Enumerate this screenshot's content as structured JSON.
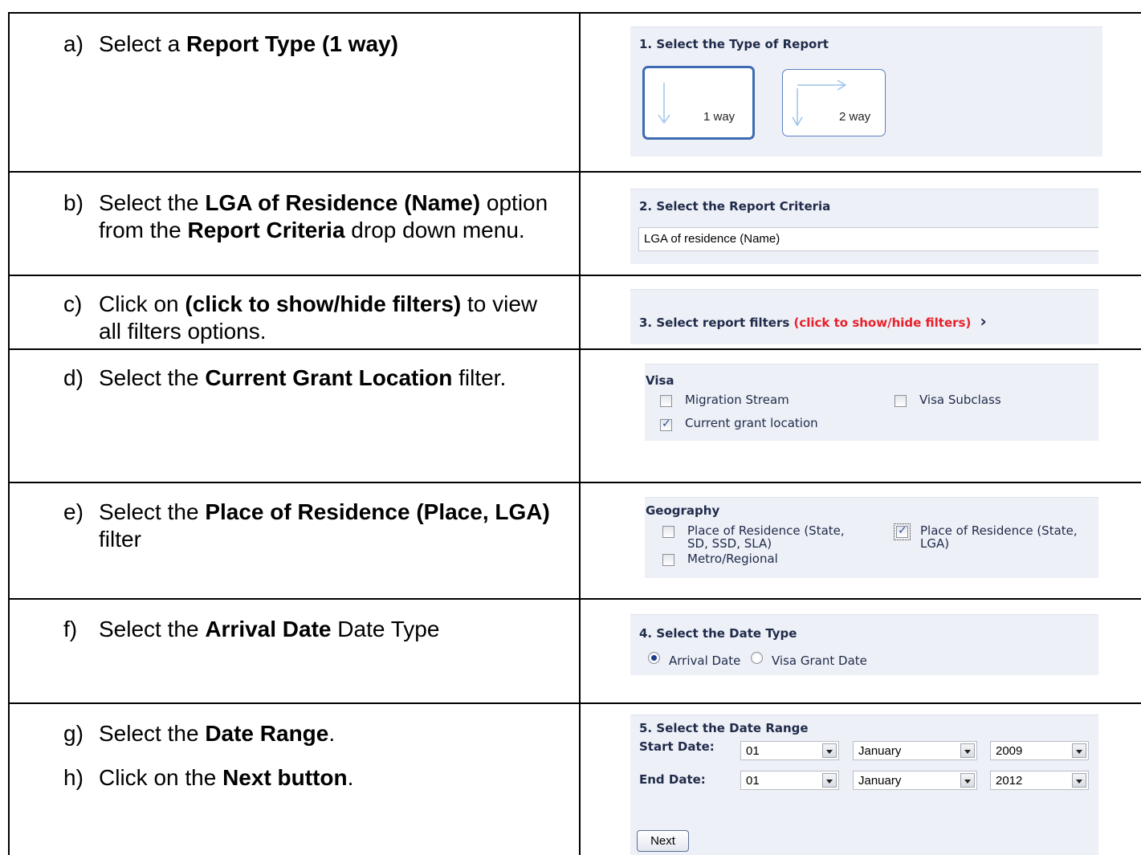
{
  "steps": [
    {
      "letter": "a)",
      "pre": "Select a ",
      "bold": "Report Type (1 way)",
      "post": ""
    },
    {
      "letter": "b)",
      "pre": "Select the ",
      "bold": "LGA of Residence (Name)",
      "mid": " option from the ",
      "bold2": "Report Criteria",
      "post": " drop down menu."
    },
    {
      "letter": "c)",
      "pre": "Click on ",
      "bold": "(click to show/hide filters)",
      "post": " to view all filters options."
    },
    {
      "letter": "d)",
      "pre": "Select the ",
      "bold": "Current Grant Location",
      "post": " filter."
    },
    {
      "letter": "e)",
      "pre": "Select the ",
      "bold": "Place of Residence (Place, LGA)",
      "post": " filter"
    },
    {
      "letter": "f)",
      "pre": "Select the ",
      "bold": "Arrival Date",
      "post": " Date Type"
    },
    {
      "letter": "g)",
      "pre": "Select the ",
      "bold": "Date Range",
      "post": "."
    },
    {
      "letter": "h)",
      "pre": "Click on the ",
      "bold": "Next button",
      "post": "."
    }
  ],
  "report_type": {
    "title": "1. Select the Type of Report",
    "options": [
      "1 way",
      "2 way"
    ],
    "selected": "1 way"
  },
  "criteria": {
    "title": "2. Select the Report Criteria",
    "value": "LGA of residence (Name)"
  },
  "filters_toggle": {
    "title": "3. Select report filters ",
    "link": "(click to show/hide filters)",
    "chevron": "›",
    "link_color": "#e8202a"
  },
  "visa": {
    "title": "Visa",
    "migration_stream": "Migration Stream",
    "current_grant_location": "Current grant location",
    "visa_subclass": "Visa Subclass"
  },
  "geography": {
    "title": "Geography",
    "place_sd_line1": "Place of Residence (State,",
    "place_sd_line2": "SD, SSD, SLA)",
    "metro": "Metro/Regional",
    "place_lga_line1": "Place of Residence (State,",
    "place_lga_line2": "LGA)"
  },
  "date_type": {
    "title": "4. Select the Date Type",
    "arrival": "Arrival Date",
    "visa_grant": "Visa Grant Date",
    "selected": "Arrival Date"
  },
  "date_range": {
    "title": "5. Select the Date Range",
    "start_label": "Start Date:",
    "end_label": "End Date:",
    "start_day": "01",
    "start_month": "January",
    "start_year": "2009",
    "end_day": "01",
    "end_month": "January",
    "end_year": "2012",
    "next": "Next"
  }
}
